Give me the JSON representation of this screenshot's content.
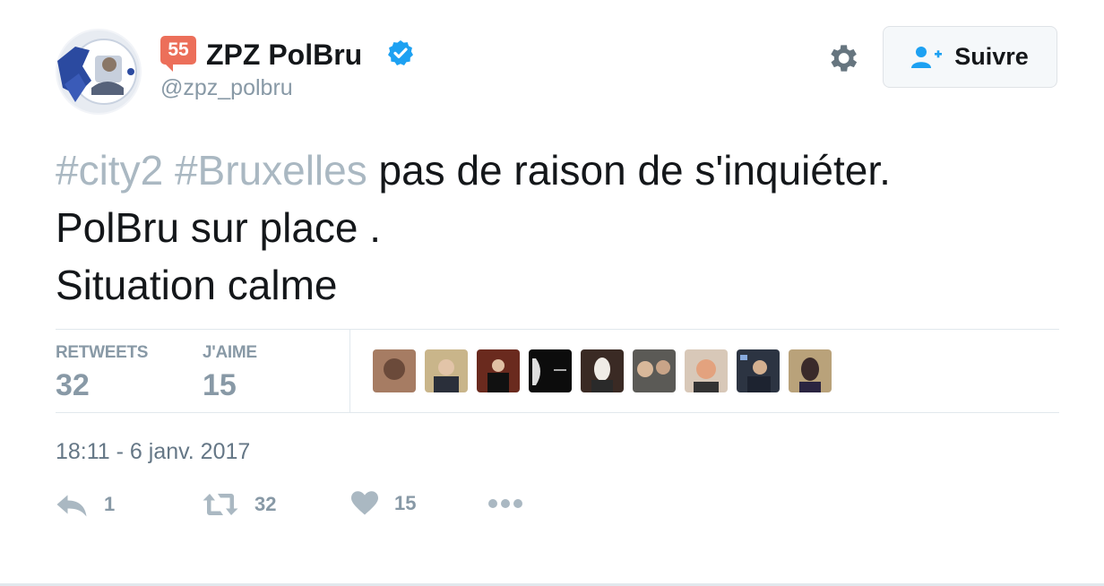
{
  "author": {
    "badge_count": "55",
    "name": "ZPZ PolBru",
    "handle": "@zpz_polbru",
    "verified": true,
    "avatar_icon": "police-seal-logo"
  },
  "header": {
    "settings_icon": "gear-icon",
    "follow_label": "Suivre",
    "follow_icon": "add-user-icon"
  },
  "tweet": {
    "tag1": "#city2",
    "tag2": "#Bruxelles",
    "text_line1_rest": "pas de raison de s'inquiéter.",
    "text_line2": "PolBru sur place .",
    "text_line3": "Situation calme"
  },
  "stats": {
    "retweets_label": "RETWEETS",
    "retweets_count": "32",
    "likes_label": "J'AIME",
    "likes_count": "15",
    "liker_count": 9
  },
  "timestamp": "18:11 - 6 janv. 2017",
  "actions": {
    "reply_count": "1",
    "retweet_count": "32",
    "like_count": "15",
    "more_icon": "more-dots-icon"
  },
  "colors": {
    "hashtag": "#aab8c2",
    "muted": "#8899a6",
    "verified": "#1da1f2",
    "badge": "#ec6f5a",
    "divider": "#e1e8ed"
  }
}
